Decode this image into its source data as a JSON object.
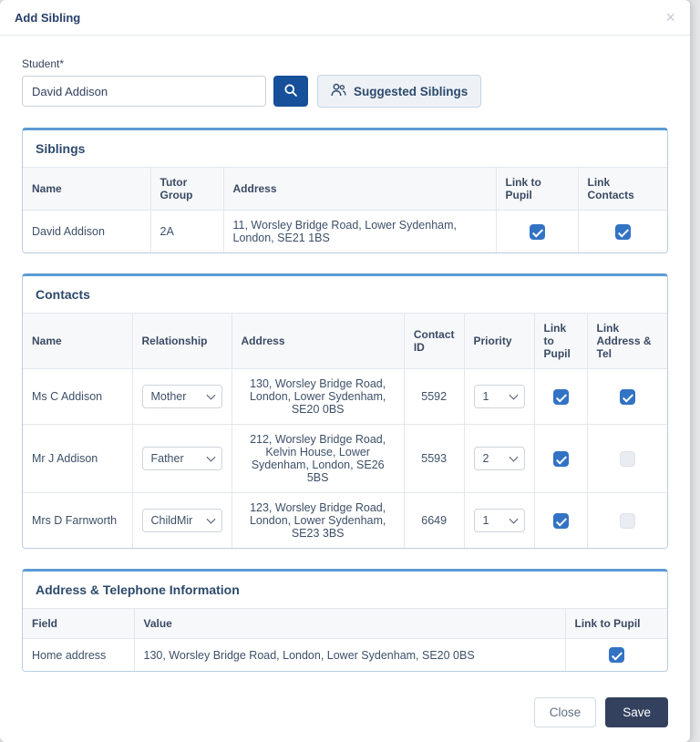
{
  "modal": {
    "title": "Add Sibling",
    "close_icon": "×"
  },
  "student": {
    "label": "Student*",
    "value": "David Addison"
  },
  "buttons": {
    "suggested_siblings": "Suggested Siblings",
    "close": "Close",
    "save": "Save"
  },
  "icons": {
    "search": "search-icon",
    "suggested_siblings": "people-icon",
    "close": "close-icon"
  },
  "colors": {
    "accent_blue": "#5b9bd5",
    "checkbox_blue": "#3273c4",
    "search_button_blue": "#164f9a",
    "save_button_navy": "#33415e"
  },
  "siblings": {
    "title": "Siblings",
    "headers": [
      "Name",
      "Tutor Group",
      "Address",
      "Link to Pupil",
      "Link Contacts"
    ],
    "rows": [
      {
        "name": "David Addison",
        "tutor_group": "2A",
        "address": "11, Worsley Bridge Road, Lower Sydenham, London, SE21 1BS",
        "link_to_pupil": true,
        "link_contacts": true
      }
    ]
  },
  "contacts": {
    "title": "Contacts",
    "headers": [
      "Name",
      "Relationship",
      "Address",
      "Contact ID",
      "Priority",
      "Link to Pupil",
      "Link Address & Tel"
    ],
    "rows": [
      {
        "name": "Ms C Addison",
        "relationship": "Mother",
        "address": "130, Worsley Bridge Road, London, Lower Sydenham, SE20 0BS",
        "contact_id": "5592",
        "priority": "1",
        "link_to_pupil": true,
        "link_address_tel": true
      },
      {
        "name": "Mr J Addison",
        "relationship": "Father",
        "address": "212, Worsley Bridge Road, Kelvin House, Lower Sydenham, London, SE26 5BS",
        "contact_id": "5593",
        "priority": "2",
        "link_to_pupil": true,
        "link_address_tel": false
      },
      {
        "name": "Mrs D Farnworth",
        "relationship": "ChildMir",
        "address": "123, Worsley Bridge Road, London, Lower Sydenham, SE23 3BS",
        "contact_id": "6649",
        "priority": "1",
        "link_to_pupil": true,
        "link_address_tel": false
      }
    ]
  },
  "address_info": {
    "title": "Address & Telephone Information",
    "headers": [
      "Field",
      "Value",
      "Link to Pupil"
    ],
    "rows": [
      {
        "field": "Home address",
        "value": "130, Worsley Bridge Road, London, Lower Sydenham, SE20 0BS",
        "link_to_pupil": true
      }
    ]
  }
}
